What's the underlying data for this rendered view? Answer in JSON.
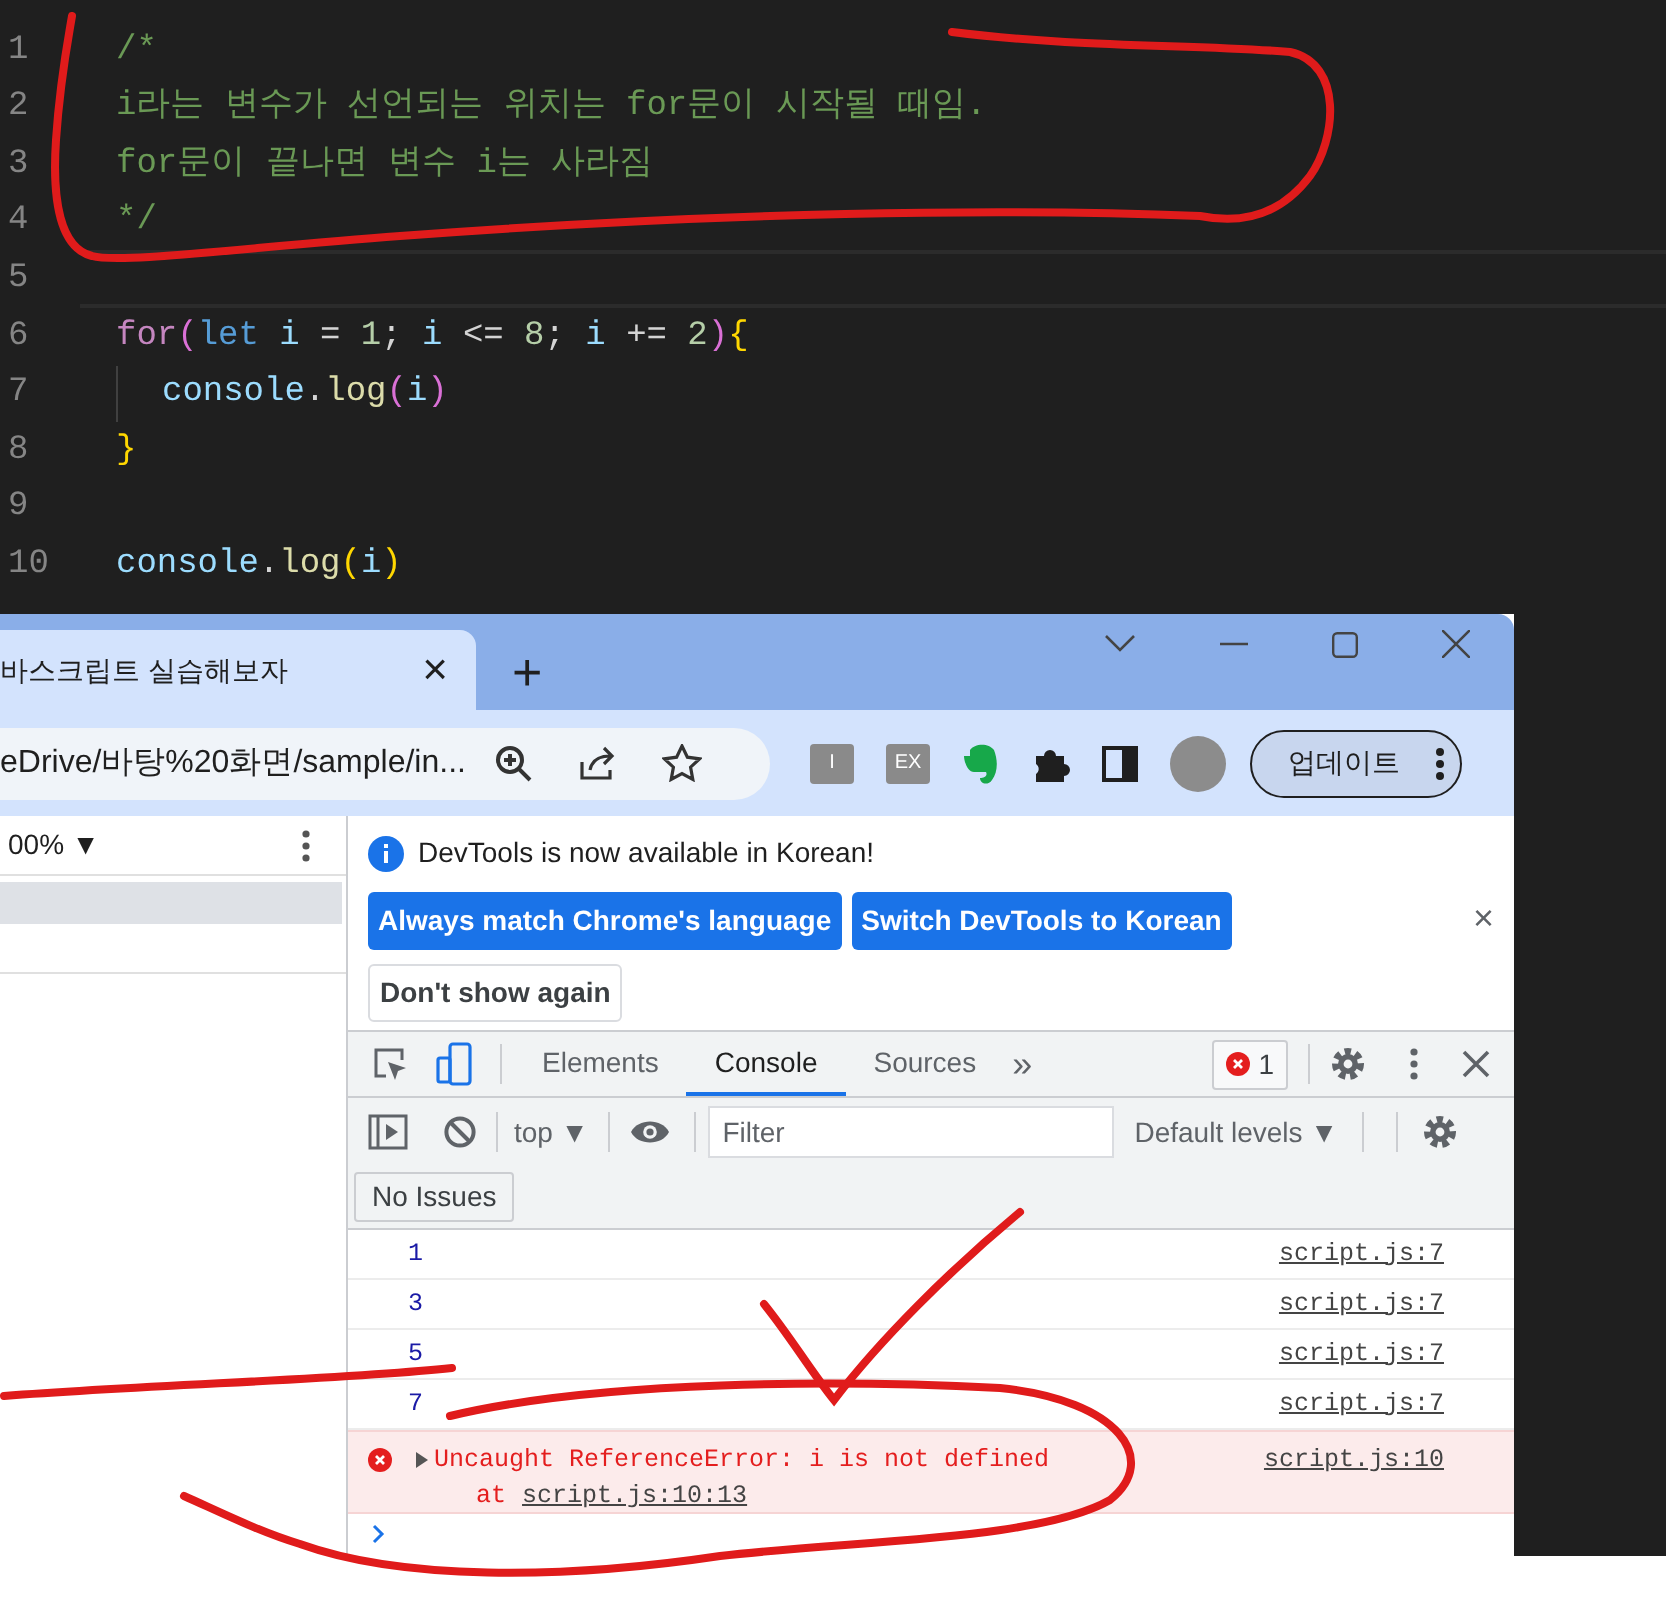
{
  "editor": {
    "lines": [
      {
        "number": "1",
        "tokens": [
          {
            "text": "/*",
            "kind": "comment"
          }
        ]
      },
      {
        "number": "2",
        "tokens": [
          {
            "text": "i라는 변수가 선언되는 위치는 for문이 시작될 때임.",
            "kind": "comment"
          }
        ]
      },
      {
        "number": "3",
        "tokens": [
          {
            "text": "for문이 끝나면 변수 i는 사라짐",
            "kind": "comment"
          }
        ]
      },
      {
        "number": "4",
        "tokens": [
          {
            "text": "*/",
            "kind": "comment"
          }
        ]
      },
      {
        "number": "5",
        "current": true
      },
      {
        "number": "6",
        "tokens": [
          {
            "text": "for",
            "kind": "control"
          },
          {
            "text": "(",
            "kind": "bracket2"
          },
          {
            "text": "let",
            "kind": "storage"
          },
          {
            "text": " i ",
            "kind": "variable"
          },
          {
            "text": "=",
            "kind": "plain"
          },
          {
            "text": " 1",
            "kind": "number"
          },
          {
            "text": "; ",
            "kind": "plain"
          },
          {
            "text": "i ",
            "kind": "variable"
          },
          {
            "text": "<=",
            "kind": "plain"
          },
          {
            "text": " 8",
            "kind": "number"
          },
          {
            "text": "; ",
            "kind": "plain"
          },
          {
            "text": "i ",
            "kind": "variable"
          },
          {
            "text": "+=",
            "kind": "plain"
          },
          {
            "text": " 2",
            "kind": "number"
          },
          {
            "text": ")",
            "kind": "bracket2"
          },
          {
            "text": "{",
            "kind": "bracket1"
          }
        ]
      },
      {
        "number": "7",
        "guide": true,
        "tokens": [
          {
            "text": "console",
            "kind": "variable"
          },
          {
            "text": ".",
            "kind": "plain"
          },
          {
            "text": "log",
            "kind": "function"
          },
          {
            "text": "(",
            "kind": "bracket2"
          },
          {
            "text": "i",
            "kind": "variable"
          },
          {
            "text": ")",
            "kind": "bracket2"
          }
        ]
      },
      {
        "number": "8",
        "tokens": [
          {
            "text": "}",
            "kind": "bracket1"
          }
        ]
      },
      {
        "number": "9"
      },
      {
        "number": "10",
        "tokens": [
          {
            "text": "console",
            "kind": "variable"
          },
          {
            "text": ".",
            "kind": "plain"
          },
          {
            "text": "log",
            "kind": "function"
          },
          {
            "text": "(",
            "kind": "bracket1"
          },
          {
            "text": "i",
            "kind": "variable"
          },
          {
            "text": ")",
            "kind": "bracket1"
          }
        ]
      }
    ]
  },
  "browser": {
    "tab": {
      "title": "바스크립트 실습해보자",
      "close": "×"
    },
    "new_tab": "+",
    "address": "eDrive/바탕%20화면/sample/in...",
    "extensions": [
      {
        "kind": "letter",
        "label": "I"
      },
      {
        "kind": "letter",
        "label": "EX"
      },
      {
        "kind": "elephant"
      },
      {
        "kind": "puzzle"
      },
      {
        "kind": "sidebar"
      }
    ],
    "update_button": "업데이트",
    "page": {
      "zoom": "00% ▼"
    },
    "devtools": {
      "infobar": {
        "message": "DevTools is now available in Korean!",
        "buttons": [
          {
            "label": "Always match Chrome's language",
            "primary": true
          },
          {
            "label": "Switch DevTools to Korean",
            "primary": true
          },
          {
            "label": "Don't show again",
            "primary": false
          }
        ],
        "close": "×"
      },
      "tabs": [
        {
          "label": "Elements",
          "selected": false
        },
        {
          "label": "Console",
          "selected": true
        },
        {
          "label": "Sources",
          "selected": false
        }
      ],
      "more_tabs": "»",
      "error_count": "1",
      "toolbar": {
        "context": "top ▼",
        "filter_placeholder": "Filter",
        "levels": "Default levels ▼"
      },
      "issues": "No Issues",
      "messages": [
        {
          "kind": "log",
          "text": "1",
          "source": "script.js:7"
        },
        {
          "kind": "log",
          "text": "3",
          "source": "script.js:7"
        },
        {
          "kind": "log",
          "text": "5",
          "source": "script.js:7"
        },
        {
          "kind": "log",
          "text": "7",
          "source": "script.js:7"
        },
        {
          "kind": "error",
          "text": "Uncaught ReferenceError: i is not defined",
          "source": "script.js:10",
          "stack_prefix": "at",
          "stack_link": "script.js:10:13"
        }
      ]
    }
  }
}
